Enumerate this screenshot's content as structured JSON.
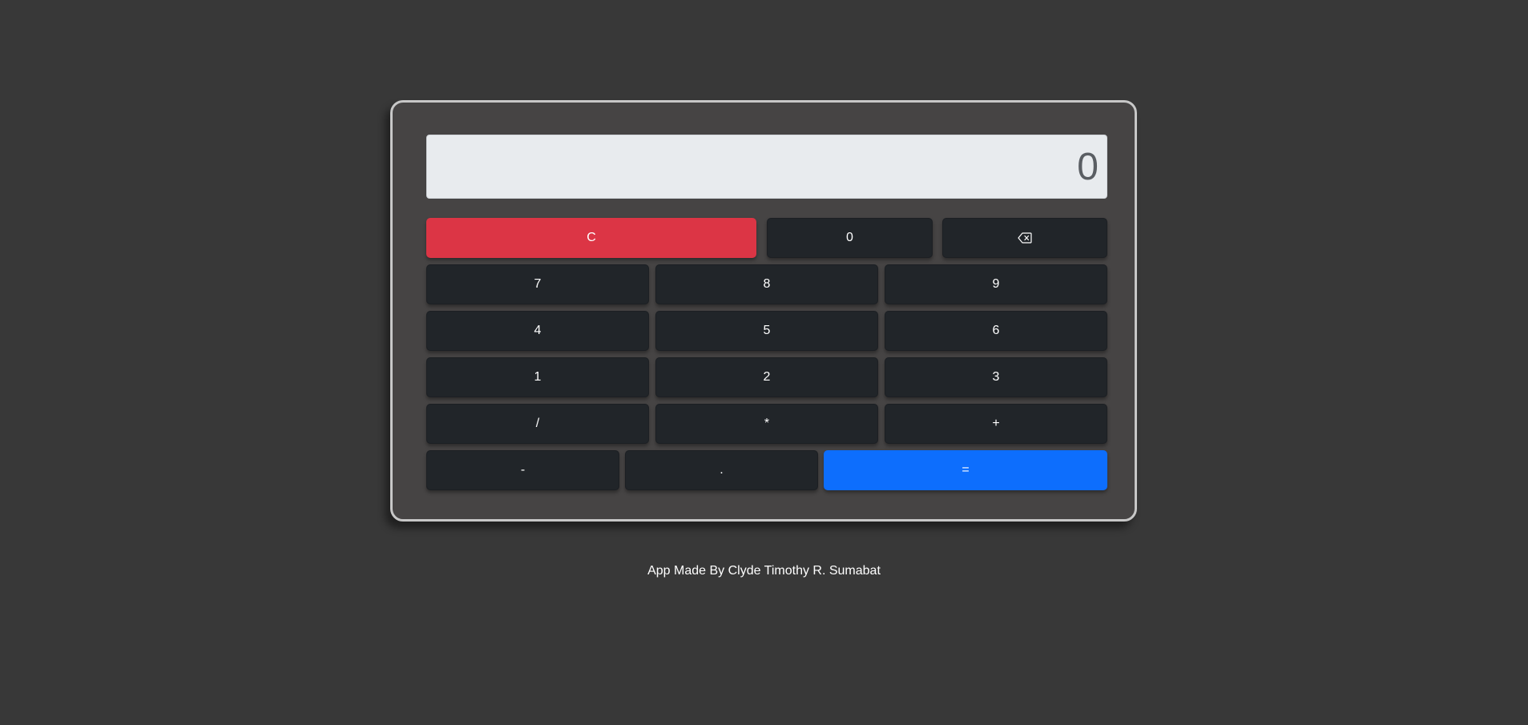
{
  "display": {
    "value": "0"
  },
  "buttons": {
    "clear": "C",
    "zero": "0",
    "backspace_icon": "backspace-icon",
    "seven": "7",
    "eight": "8",
    "nine": "9",
    "four": "4",
    "five": "5",
    "six": "6",
    "one": "1",
    "two": "2",
    "three": "3",
    "divide": "/",
    "multiply": "*",
    "plus": "+",
    "minus": "-",
    "decimal": ".",
    "equals": "="
  },
  "footer": {
    "credit": "App Made By Clyde Timothy R. Sumabat"
  },
  "colors": {
    "background": "#383838",
    "panel": "#464444",
    "button": "#212529",
    "clear": "#dc3545",
    "equals": "#0d6efd",
    "display": "#e8ebee"
  }
}
